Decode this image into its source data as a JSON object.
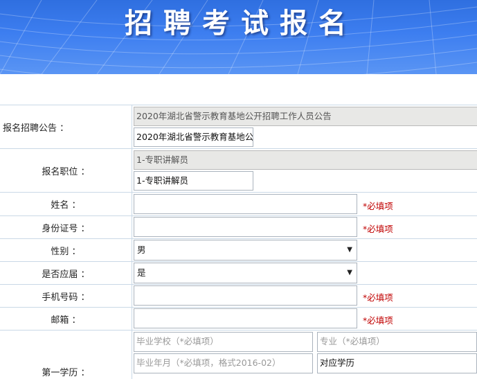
{
  "banner": {
    "title": "招聘考试报名"
  },
  "form": {
    "announcement": {
      "label": "报名招聘公告 ：",
      "display": "2020年湖北省警示教育基地公开招聘工作人员公告",
      "value": "2020年湖北省警示教育基地公开招聘工作人员公告"
    },
    "position": {
      "label": "报名职位 ：",
      "display": "1-专职讲解员",
      "value": "1-专职讲解员"
    },
    "name": {
      "label": "姓名 ：",
      "value": "",
      "required": "*必填项"
    },
    "id_number": {
      "label": "身份证号 ：",
      "value": "",
      "required": "*必填项"
    },
    "gender": {
      "label": "性别 ：",
      "selected": "男"
    },
    "fresh_graduate": {
      "label": "是否应届 ：",
      "selected": "是"
    },
    "phone": {
      "label": "手机号码 ：",
      "value": "",
      "required": "*必填项"
    },
    "email": {
      "label": "邮箱 ：",
      "value": "",
      "required": "*必填项"
    },
    "education": {
      "label": "第一学历 ：",
      "school_placeholder": "毕业学校（*必填项）",
      "major_placeholder": "专业（*必填项）",
      "grad_date_placeholder": "毕业年月（*必填项，格式2016-02）",
      "degree_value": "对应学历"
    }
  },
  "colors": {
    "required": "#c00000",
    "banner": "#3d7ef0",
    "readonly_bg": "#e8e8e6"
  },
  "icons": {
    "dropdown": "triangle-down"
  }
}
